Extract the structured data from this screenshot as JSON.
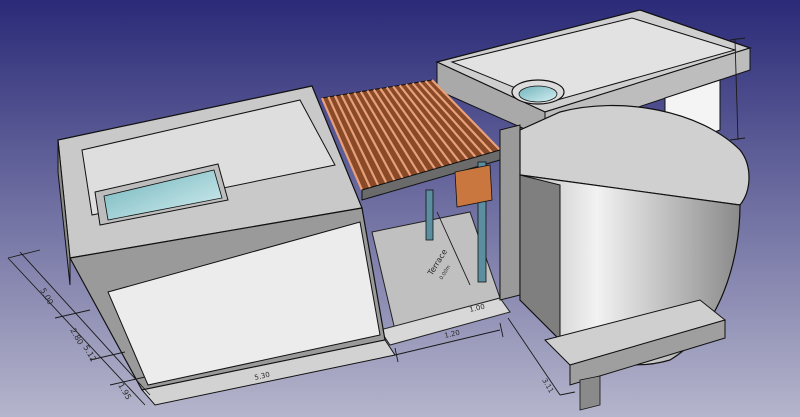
{
  "app": {
    "view": "3D viewport"
  },
  "colors": {
    "background_top": "#2a2a78",
    "background_bottom": "#a9a9c2",
    "wall_light": "#e6e6e6",
    "wall_mid": "#c4c4c4",
    "wall_dark": "#8f8f8f",
    "edge": "#111111",
    "wood": "#b0643a",
    "glass": "#9fd1d6",
    "floor": "#b8b8b8"
  },
  "annotations": {
    "terrace_label": "Terrace",
    "terrace_sub": "0.00m",
    "dim_left_1": "5.00",
    "dim_left_2": "2.80",
    "dim_left_3": "5.12",
    "dim_left_4": "1.95",
    "dim_bottom_1": "1.20",
    "dim_bottom_2": "1.00",
    "dim_bottom_3": "5.30",
    "dim_right_1": "3.11"
  }
}
